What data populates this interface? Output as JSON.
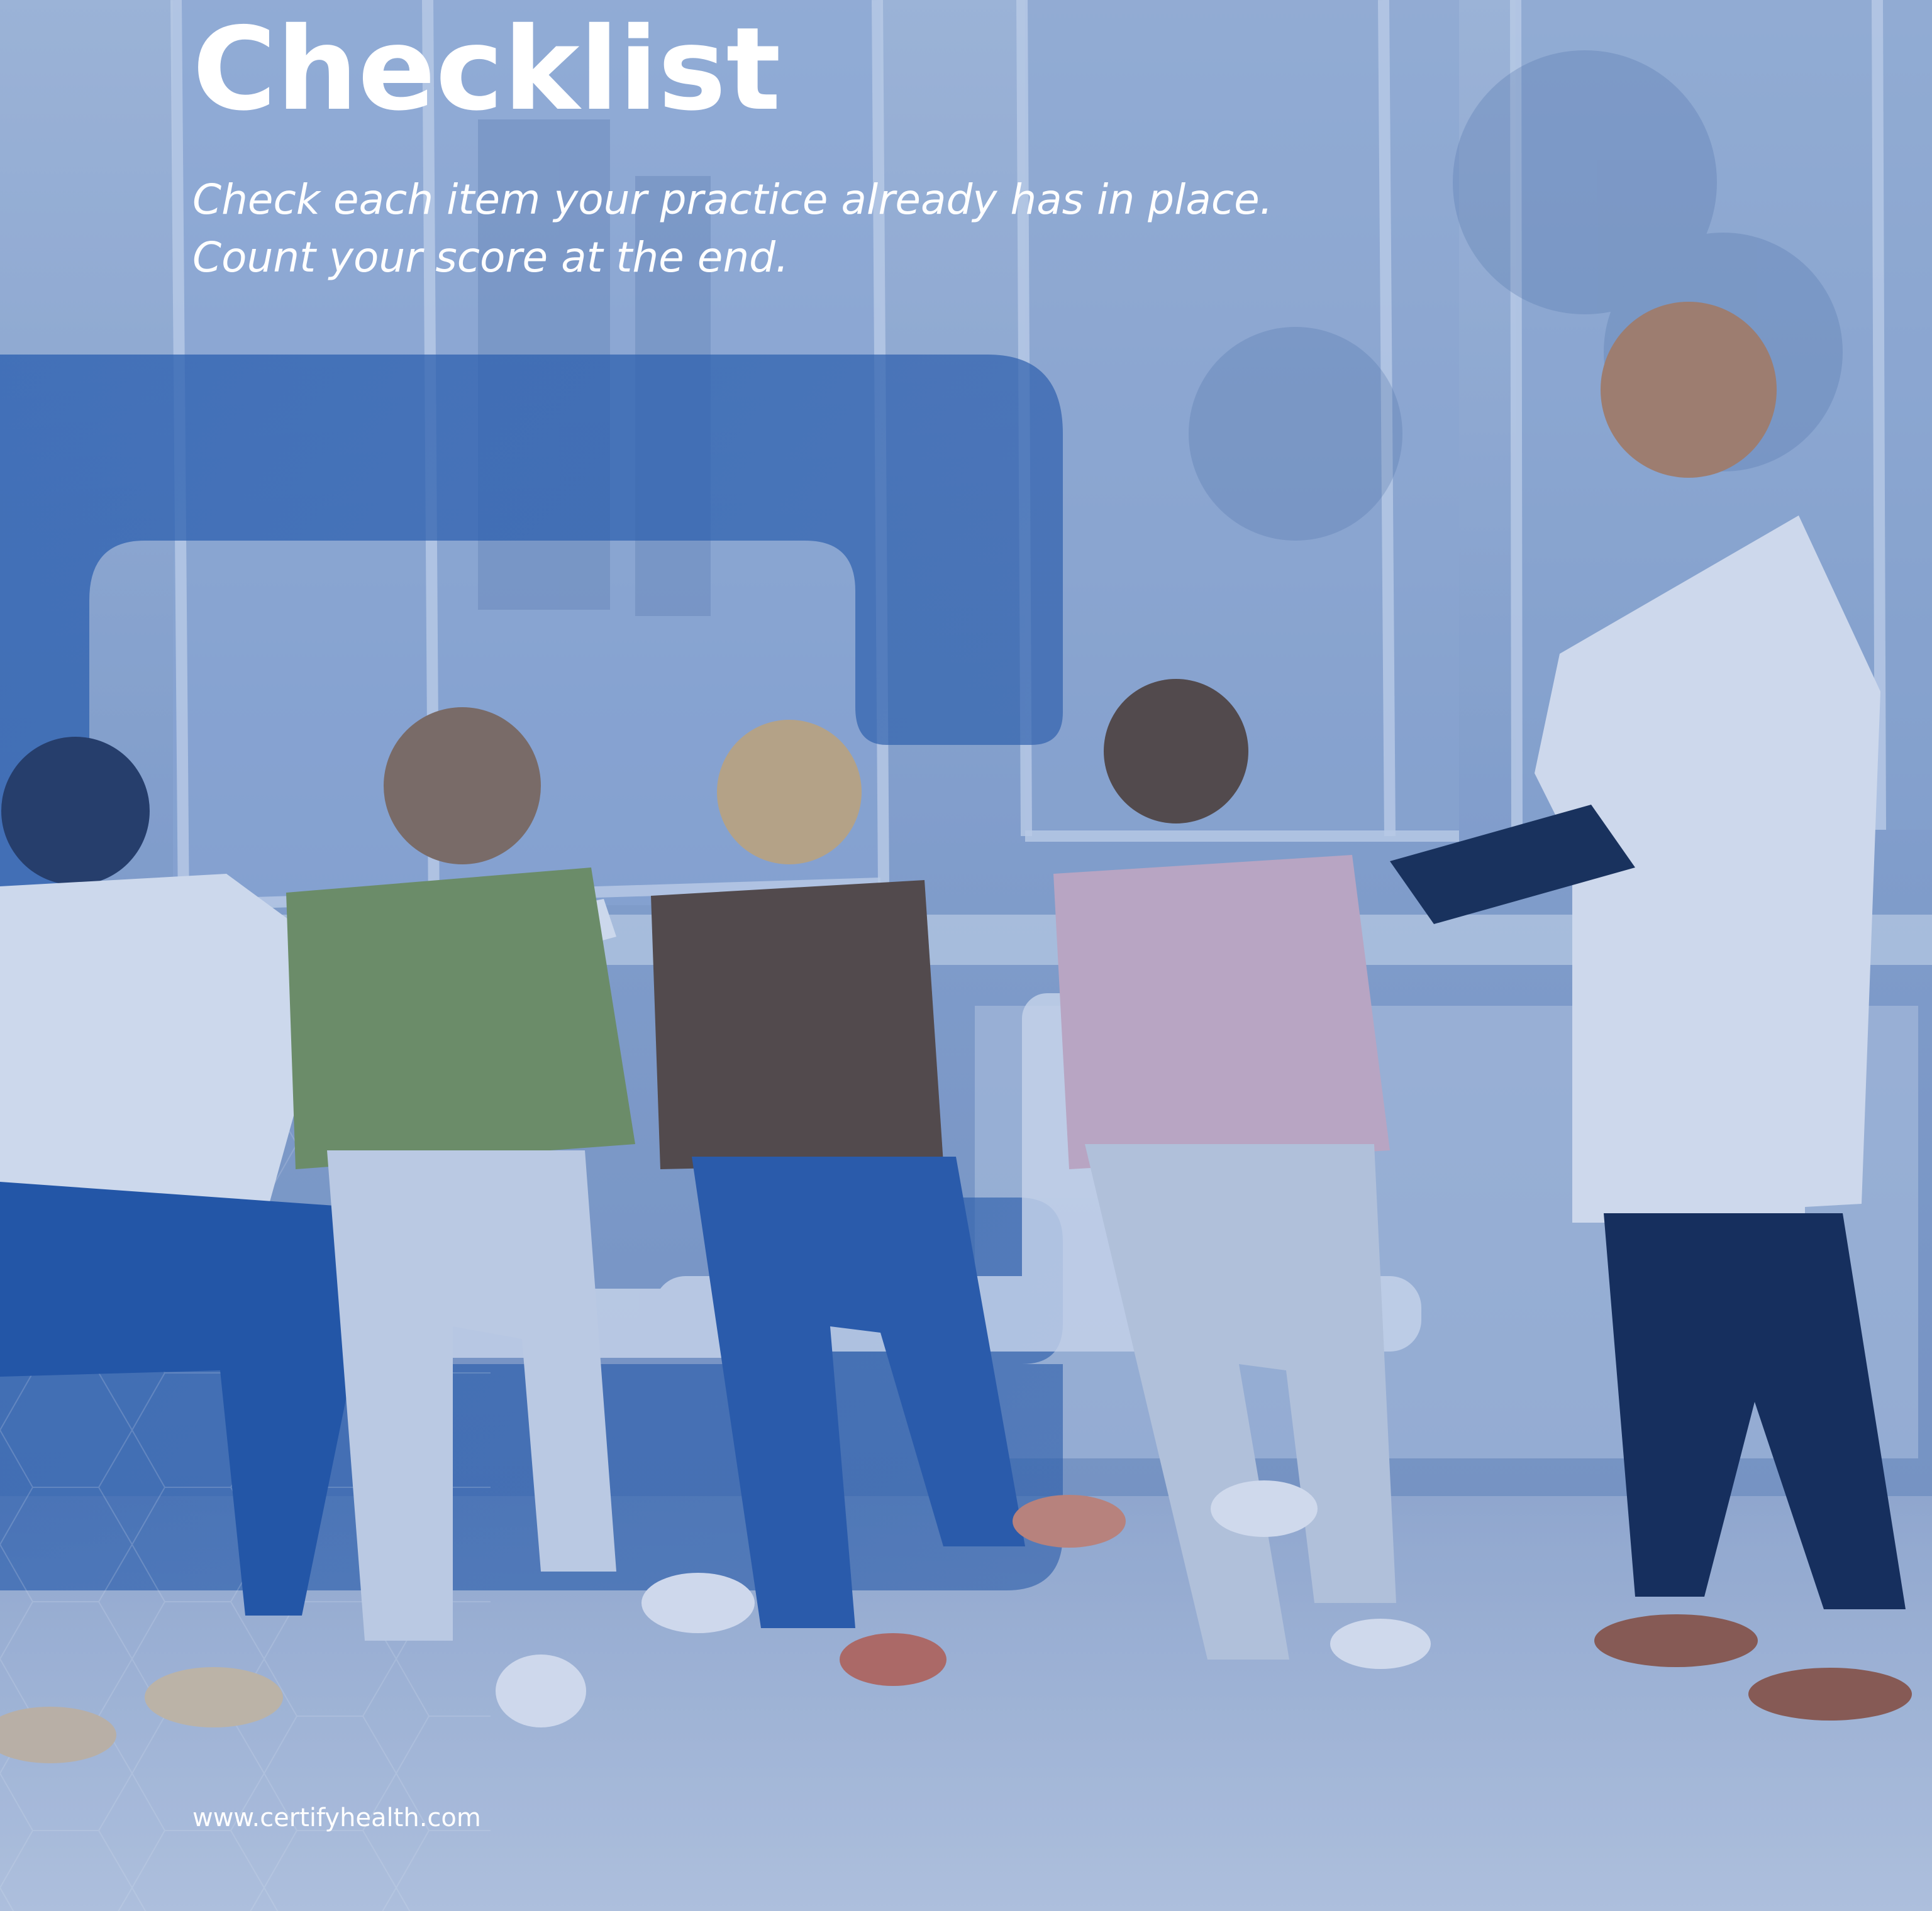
{
  "page": {
    "title": "Checklist",
    "instructions": [
      "Check each item your practice already has in place.",
      "Count your score at the end."
    ],
    "website": "www.certifyhealth.com"
  },
  "colors": {
    "brand_blue": "#1f4f9b",
    "overlay_blue": "#2f63b2",
    "text": "#ffffff"
  },
  "icons": [
    "hexagon-pattern-icon",
    "brand-shape-icon"
  ]
}
